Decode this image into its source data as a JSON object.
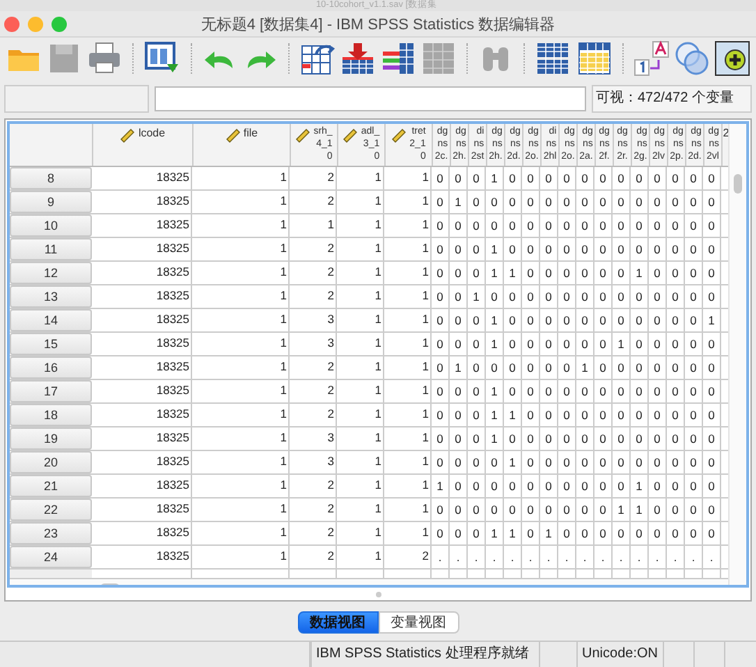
{
  "background_window": {
    "title": "10-10cohort_v1.1.sav [数据集"
  },
  "window": {
    "title": "无标题4 [数据集4] - IBM SPSS Statistics 数据编辑器"
  },
  "toolbar_groups": [
    [
      {
        "kind": "folder",
        "disabled": false
      },
      {
        "kind": "save",
        "disabled": true
      },
      {
        "kind": "print",
        "disabled": false
      }
    ],
    [
      {
        "kind": "import",
        "disabled": false
      }
    ],
    [
      {
        "kind": "undo",
        "disabled": false
      },
      {
        "kind": "redo",
        "disabled": false
      }
    ],
    [
      {
        "kind": "goto",
        "disabled": false
      },
      {
        "kind": "insert",
        "disabled": false
      },
      {
        "kind": "bars",
        "disabled": false
      },
      {
        "kind": "grid",
        "disabled": true
      }
    ],
    [
      {
        "kind": "find",
        "disabled": true
      }
    ],
    [
      {
        "kind": "split",
        "disabled": false
      },
      {
        "kind": "weight",
        "disabled": false
      }
    ],
    [
      {
        "kind": "labels",
        "disabled": false
      },
      {
        "kind": "sets",
        "disabled": false
      },
      {
        "kind": "add",
        "disabled": false
      }
    ]
  ],
  "cell_editor": {
    "visible_count": "可视：472/472 个变量"
  },
  "table": {
    "columns": [
      {
        "label": "lcode",
        "kind": "scale"
      },
      {
        "label": "file",
        "kind": "scale"
      },
      {
        "label": "srh_\n4_1\n0",
        "kind": "scale"
      },
      {
        "label": "adl_\n3_1\n0",
        "kind": "scale"
      },
      {
        "label": "tret\n2_1\n0",
        "kind": "scale"
      },
      {
        "label": "dg\nns\n2c.",
        "kind": "plain"
      },
      {
        "label": "dg\nns\n2h.",
        "kind": "plain"
      },
      {
        "label": "di\nns\n2st",
        "kind": "plain"
      },
      {
        "label": "dg\nns\n2h.",
        "kind": "plain"
      },
      {
        "label": "dg\nns\n2d.",
        "kind": "plain"
      },
      {
        "label": "dg\nns\n2o.",
        "kind": "plain"
      },
      {
        "label": "di\nns\n2hl",
        "kind": "plain"
      },
      {
        "label": "dg\nns\n2o.",
        "kind": "plain"
      },
      {
        "label": "dg\nns\n2a.",
        "kind": "plain"
      },
      {
        "label": "dg\nns\n2f.",
        "kind": "plain"
      },
      {
        "label": "dg\nns\n2r.",
        "kind": "plain"
      },
      {
        "label": "dg\nns\n2g.",
        "kind": "plain"
      },
      {
        "label": "dg\nns\n2lv",
        "kind": "plain"
      },
      {
        "label": "dg\nns\n2p.",
        "kind": "plain"
      },
      {
        "label": "dg\nns\n2d.",
        "kind": "plain"
      },
      {
        "label": "dg\nns\n2vl",
        "kind": "plain"
      },
      {
        "label": "2",
        "kind": "plain"
      }
    ],
    "rows": [
      {
        "row": "8",
        "cells": [
          "18325",
          "1",
          "2",
          "1",
          "1",
          "0",
          "0",
          "0",
          "1",
          "0",
          "0",
          "0",
          "0",
          "0",
          "0",
          "0",
          "0",
          "0",
          "0",
          "0",
          "0"
        ]
      },
      {
        "row": "9",
        "cells": [
          "18325",
          "1",
          "2",
          "1",
          "1",
          "0",
          "1",
          "0",
          "0",
          "0",
          "0",
          "0",
          "0",
          "0",
          "0",
          "0",
          "0",
          "0",
          "0",
          "0",
          "0"
        ]
      },
      {
        "row": "10",
        "cells": [
          "18325",
          "1",
          "1",
          "1",
          "1",
          "0",
          "0",
          "0",
          "0",
          "0",
          "0",
          "0",
          "0",
          "0",
          "0",
          "0",
          "0",
          "0",
          "0",
          "0",
          "0"
        ]
      },
      {
        "row": "11",
        "cells": [
          "18325",
          "1",
          "2",
          "1",
          "1",
          "0",
          "0",
          "0",
          "1",
          "0",
          "0",
          "0",
          "0",
          "0",
          "0",
          "0",
          "0",
          "0",
          "0",
          "0",
          "0"
        ]
      },
      {
        "row": "12",
        "cells": [
          "18325",
          "1",
          "2",
          "1",
          "1",
          "0",
          "0",
          "0",
          "1",
          "1",
          "0",
          "0",
          "0",
          "0",
          "0",
          "0",
          "1",
          "0",
          "0",
          "0",
          "0"
        ]
      },
      {
        "row": "13",
        "cells": [
          "18325",
          "1",
          "2",
          "1",
          "1",
          "0",
          "0",
          "1",
          "0",
          "0",
          "0",
          "0",
          "0",
          "0",
          "0",
          "0",
          "0",
          "0",
          "0",
          "0",
          "0"
        ]
      },
      {
        "row": "14",
        "cells": [
          "18325",
          "1",
          "3",
          "1",
          "1",
          "0",
          "0",
          "0",
          "1",
          "0",
          "0",
          "0",
          "0",
          "0",
          "0",
          "0",
          "0",
          "0",
          "0",
          "0",
          "1"
        ]
      },
      {
        "row": "15",
        "cells": [
          "18325",
          "1",
          "3",
          "1",
          "1",
          "0",
          "0",
          "0",
          "1",
          "0",
          "0",
          "0",
          "0",
          "0",
          "0",
          "1",
          "0",
          "0",
          "0",
          "0",
          "0"
        ]
      },
      {
        "row": "16",
        "cells": [
          "18325",
          "1",
          "2",
          "1",
          "1",
          "0",
          "1",
          "0",
          "0",
          "0",
          "0",
          "0",
          "0",
          "1",
          "0",
          "0",
          "0",
          "0",
          "0",
          "0",
          "0"
        ]
      },
      {
        "row": "17",
        "cells": [
          "18325",
          "1",
          "2",
          "1",
          "1",
          "0",
          "0",
          "0",
          "1",
          "0",
          "0",
          "0",
          "0",
          "0",
          "0",
          "0",
          "0",
          "0",
          "0",
          "0",
          "0"
        ]
      },
      {
        "row": "18",
        "cells": [
          "18325",
          "1",
          "2",
          "1",
          "1",
          "0",
          "0",
          "0",
          "1",
          "1",
          "0",
          "0",
          "0",
          "0",
          "0",
          "0",
          "0",
          "0",
          "0",
          "0",
          "0"
        ]
      },
      {
        "row": "19",
        "cells": [
          "18325",
          "1",
          "3",
          "1",
          "1",
          "0",
          "0",
          "0",
          "1",
          "0",
          "0",
          "0",
          "0",
          "0",
          "0",
          "0",
          "0",
          "0",
          "0",
          "0",
          "0"
        ]
      },
      {
        "row": "20",
        "cells": [
          "18325",
          "1",
          "3",
          "1",
          "1",
          "0",
          "0",
          "0",
          "0",
          "1",
          "0",
          "0",
          "0",
          "0",
          "0",
          "0",
          "0",
          "0",
          "0",
          "0",
          "0"
        ]
      },
      {
        "row": "21",
        "cells": [
          "18325",
          "1",
          "2",
          "1",
          "1",
          "1",
          "0",
          "0",
          "0",
          "0",
          "0",
          "0",
          "0",
          "0",
          "0",
          "0",
          "1",
          "0",
          "0",
          "0",
          "0"
        ]
      },
      {
        "row": "22",
        "cells": [
          "18325",
          "1",
          "2",
          "1",
          "1",
          "0",
          "0",
          "0",
          "0",
          "0",
          "0",
          "0",
          "0",
          "0",
          "0",
          "1",
          "1",
          "0",
          "0",
          "0",
          "0"
        ]
      },
      {
        "row": "23",
        "cells": [
          "18325",
          "1",
          "2",
          "1",
          "1",
          "0",
          "0",
          "0",
          "1",
          "1",
          "0",
          "1",
          "0",
          "0",
          "0",
          "0",
          "0",
          "0",
          "0",
          "0",
          "0"
        ]
      },
      {
        "row": "24",
        "cells": [
          "18325",
          "1",
          "2",
          "1",
          "2",
          ".",
          ".",
          ".",
          ".",
          ".",
          ".",
          ".",
          ".",
          ".",
          ".",
          ".",
          ".",
          ".",
          ".",
          ".",
          "."
        ]
      }
    ]
  },
  "view_tabs": [
    {
      "label": "数据视图",
      "selected": true
    },
    {
      "label": "变量视图",
      "selected": false
    }
  ],
  "status_bar": [
    "IBM SPSS Statistics 处理程序就绪",
    "Unicode:ON"
  ]
}
